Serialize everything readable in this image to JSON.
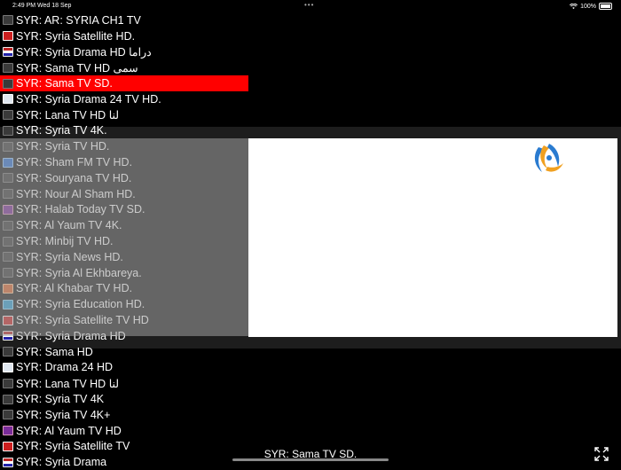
{
  "status": {
    "time": "2:49 PM",
    "date": "Wed 18 Sep",
    "battery": "100%"
  },
  "channels": [
    {
      "label": "SYR: AR: SYRIA CH1 TV",
      "icon": "channel-logo-icon",
      "style": ""
    },
    {
      "label": "SYR: Syria Satellite HD.",
      "icon": "syria-satellite-logo-icon",
      "style": "red"
    },
    {
      "label": "SYR: Syria Drama HD دراما",
      "icon": "syria-drama-logo-icon",
      "style": "flag"
    },
    {
      "label": "SYR: Sama TV HD سمى",
      "icon": "channel-logo-icon",
      "style": ""
    },
    {
      "label": "SYR: Sama TV SD.",
      "icon": "channel-logo-icon",
      "style": "",
      "selected": true
    },
    {
      "label": "SYR: Syria Drama 24 TV HD.",
      "icon": "drama-24-logo-icon",
      "style": "light"
    },
    {
      "label": "SYR: Lana TV HD لنا",
      "icon": "channel-logo-icon",
      "style": ""
    },
    {
      "label": "SYR: Syria TV 4K.",
      "icon": "channel-logo-icon",
      "style": ""
    },
    {
      "label": "SYR: Syria TV HD.",
      "icon": "channel-logo-icon",
      "style": ""
    },
    {
      "label": "SYR: Sham FM TV HD.",
      "icon": "sham-fm-logo-icon",
      "style": "blue"
    },
    {
      "label": "SYR: Souryana TV HD.",
      "icon": "channel-logo-icon",
      "style": ""
    },
    {
      "label": "SYR: Nour Al Sham HD.",
      "icon": "channel-logo-icon",
      "style": ""
    },
    {
      "label": "SYR: Halab Today TV SD.",
      "icon": "halab-today-logo-icon",
      "style": "purple"
    },
    {
      "label": "SYR: Al Yaum TV 4K.",
      "icon": "channel-logo-icon",
      "style": ""
    },
    {
      "label": "SYR: Minbij TV HD.",
      "icon": "channel-logo-icon",
      "style": ""
    },
    {
      "label": "SYR: Syria News HD.",
      "icon": "channel-logo-icon",
      "style": ""
    },
    {
      "label": "SYR: Syria Al Ekhbareya.",
      "icon": "channel-logo-icon",
      "style": ""
    },
    {
      "label": "SYR: Al Khabar TV HD.",
      "icon": "al-khabar-logo-icon",
      "style": "orange"
    },
    {
      "label": "SYR: Syria Education HD.",
      "icon": "education-logo-icon",
      "style": "cyan"
    },
    {
      "label": "SYR: Syria Satellite TV HD",
      "icon": "syria-satellite-logo-icon",
      "style": "red"
    },
    {
      "label": "SYR: Syria Drama HD",
      "icon": "syria-drama-logo-icon",
      "style": "flag"
    },
    {
      "label": "SYR: Sama HD",
      "icon": "channel-logo-icon",
      "style": ""
    },
    {
      "label": "SYR: Drama 24 HD",
      "icon": "drama-24-logo-icon",
      "style": "light"
    },
    {
      "label": "SYR: Lana TV HD لنا",
      "icon": "channel-logo-icon",
      "style": ""
    },
    {
      "label": "SYR: Syria TV 4K",
      "icon": "channel-logo-icon",
      "style": ""
    },
    {
      "label": "SYR: Syria TV 4K+",
      "icon": "channel-logo-icon",
      "style": ""
    },
    {
      "label": "SYR: Al Yaum TV HD",
      "icon": "al-yaum-logo-icon",
      "style": "purple"
    },
    {
      "label": "SYR: Syria Satellite TV",
      "icon": "syria-satellite-logo-icon",
      "style": "red"
    },
    {
      "label": "SYR: Syria Drama",
      "icon": "syria-drama-logo-icon",
      "style": "flag"
    }
  ],
  "now_playing": "SYR: Sama TV SD.",
  "colors": {
    "selected_row": "#ff0000",
    "background": "#000000"
  }
}
